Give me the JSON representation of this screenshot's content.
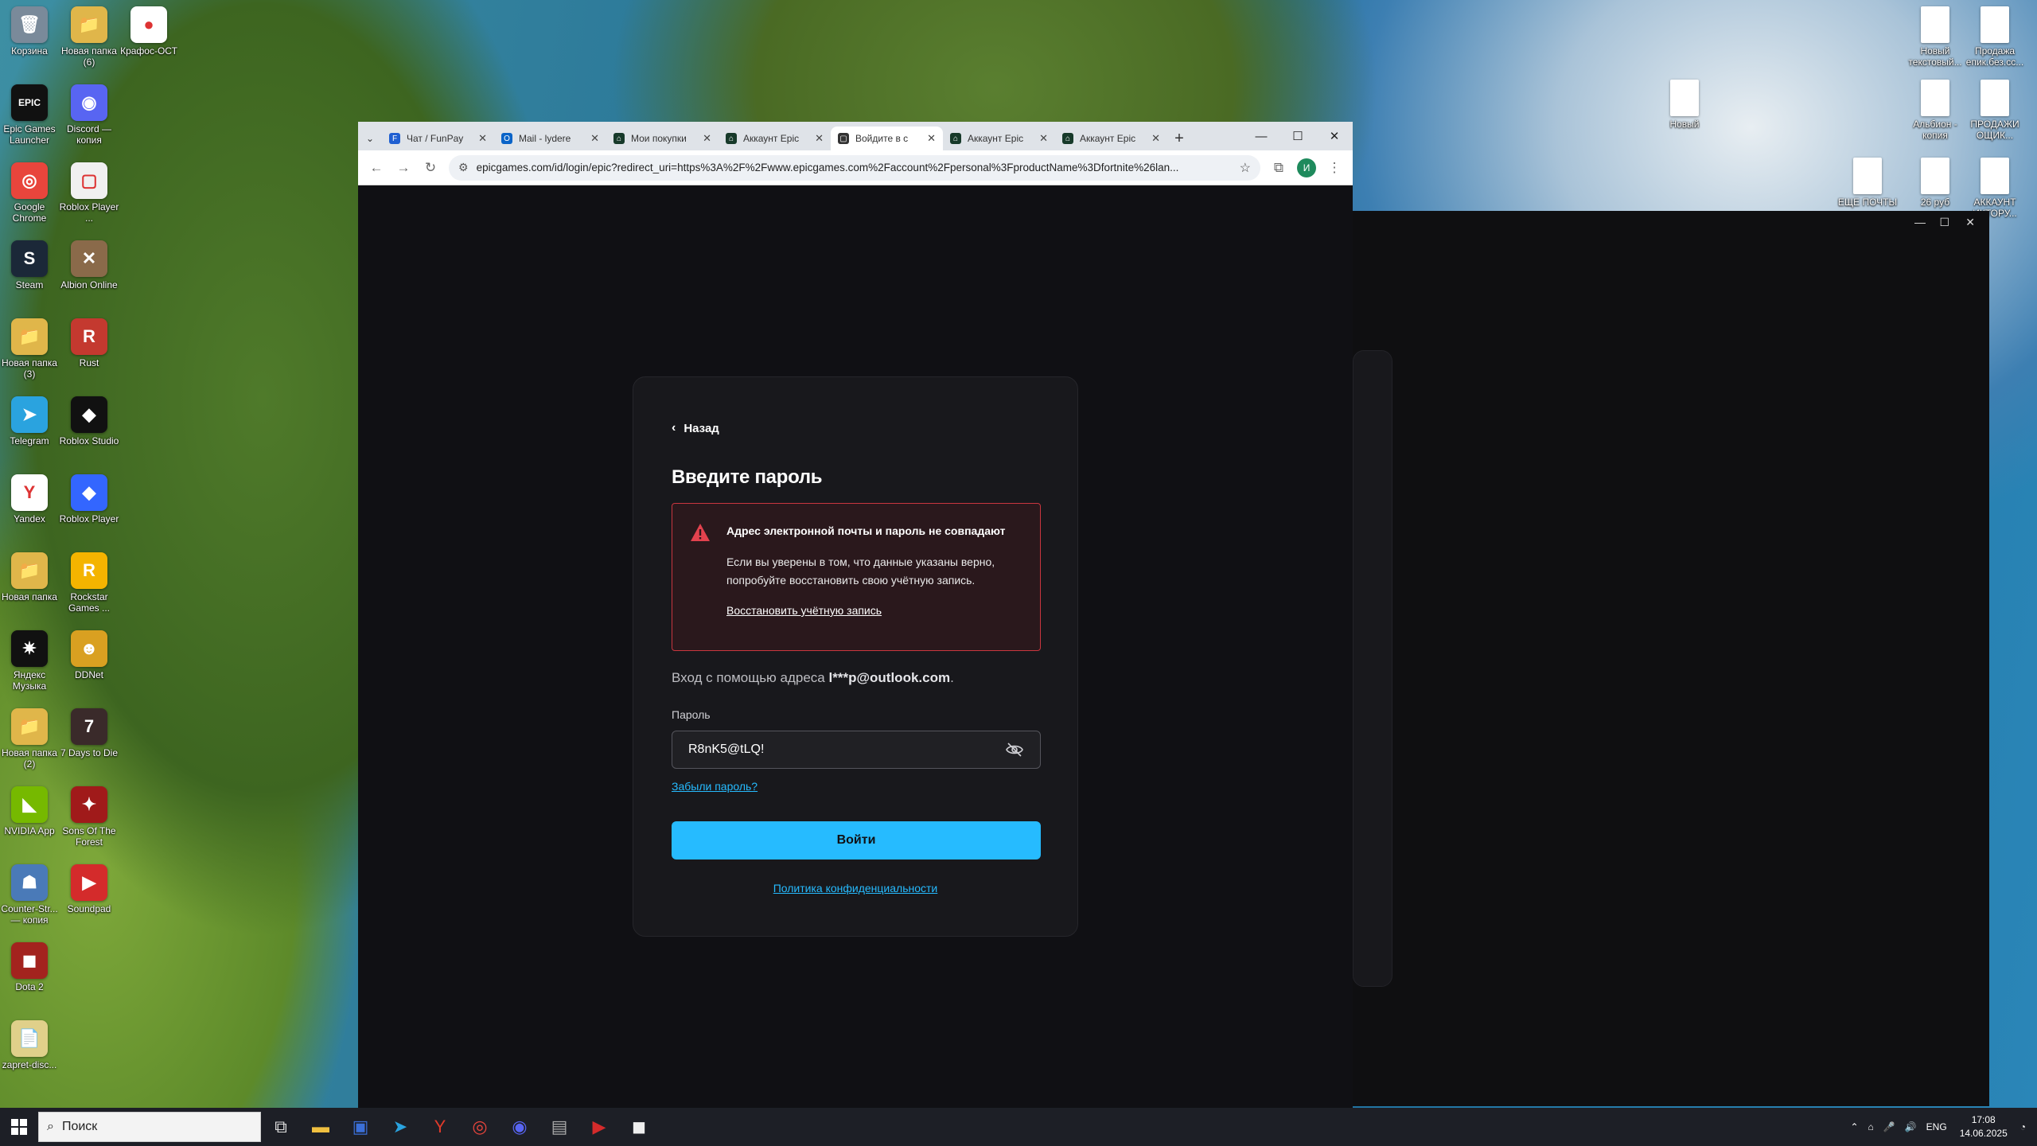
{
  "desktop": {
    "left_icons": [
      {
        "label": "Корзина",
        "color": "#7a8a9a",
        "glyph": "🗑"
      },
      {
        "label": "Новая папка (6)",
        "color": "#e0b64a",
        "glyph": "📁"
      },
      {
        "label": "Крафос-ОСТ",
        "color": "#ffffff",
        "glyph": "●"
      },
      {
        "label": "Epic Games Launcher",
        "color": "#111111",
        "glyph": "EPIC"
      },
      {
        "label": "Discord — копия",
        "color": "#5865f2",
        "glyph": "◉"
      },
      {
        "label": "Google Chrome",
        "color": "#e8453c",
        "glyph": "◎"
      },
      {
        "label": "Roblox Player ...",
        "color": "#f0f0f0",
        "glyph": "▢"
      },
      {
        "label": "Steam",
        "color": "#1b2838",
        "glyph": "S"
      },
      {
        "label": "Albion Online",
        "color": "#8a6a4a",
        "glyph": "✕"
      },
      {
        "label": "Новая папка (3)",
        "color": "#e0b64a",
        "glyph": "📁"
      },
      {
        "label": "Rust",
        "color": "#c4392f",
        "glyph": "R"
      },
      {
        "label": "Telegram",
        "color": "#2aa3df",
        "glyph": "➤"
      },
      {
        "label": "Roblox Studio",
        "color": "#111111",
        "glyph": "◆"
      },
      {
        "label": "Yandex",
        "color": "#ffffff",
        "glyph": "Y"
      },
      {
        "label": "Roblox Player",
        "color": "#3366ff",
        "glyph": "◆"
      },
      {
        "label": "Новая папка",
        "color": "#e0b64a",
        "glyph": "📁"
      },
      {
        "label": "Rockstar Games ...",
        "color": "#f4b400",
        "glyph": "R"
      },
      {
        "label": "Яндекс Музыка",
        "color": "#111111",
        "glyph": "✷"
      },
      {
        "label": "DDNet",
        "color": "#d9a021",
        "glyph": "☻"
      },
      {
        "label": "Новая папка (2)",
        "color": "#e0b64a",
        "glyph": "📁"
      },
      {
        "label": "7 Days to Die",
        "color": "#3a2a2a",
        "glyph": "7"
      },
      {
        "label": "NVIDIA App",
        "color": "#76b900",
        "glyph": "◣"
      },
      {
        "label": "Sons Of The Forest",
        "color": "#a01a1a",
        "glyph": "✦"
      },
      {
        "label": "Counter-Str... — копия",
        "color": "#4a7ab8",
        "glyph": "☗"
      },
      {
        "label": "Soundpad",
        "color": "#d42b2b",
        "glyph": "▶"
      },
      {
        "label": "Dota 2",
        "color": "#a3231e",
        "glyph": "◼"
      },
      {
        "label": "zapret-disc...",
        "color": "#e0d08a",
        "glyph": "📄"
      }
    ],
    "right_icons": [
      {
        "label": "Новый текстовый...",
        "color": "#ffffff"
      },
      {
        "label": "Продажа епик.без.сс...",
        "color": "#ffffff"
      },
      {
        "label": "Новый",
        "color": "#ffffff"
      },
      {
        "label": "Альбион - копия",
        "color": "#ffffff"
      },
      {
        "label": "ПРОДАЖИ ОЩИК...",
        "color": "#ffffff"
      },
      {
        "label": "ЕЩЕ ПОЧТЫ",
        "color": "#ffffff"
      },
      {
        "label": "26 руб",
        "color": "#ffffff"
      },
      {
        "label": "АККАУНТ ИКТОРУ...",
        "color": "#ffffff"
      }
    ]
  },
  "browser": {
    "tabs": [
      {
        "title": "Чат / FunPay",
        "fav": "#1f5fd1",
        "glyph": "F",
        "active": false
      },
      {
        "title": "Mail - lydere",
        "fav": "#0a64c8",
        "glyph": "O",
        "active": false
      },
      {
        "title": "Мои покупки",
        "fav": "#173a2a",
        "glyph": "⌂",
        "active": false
      },
      {
        "title": "Аккаунт Epic",
        "fav": "#173a2a",
        "glyph": "⌂",
        "active": false
      },
      {
        "title": "Войдите в с",
        "fav": "#333333",
        "glyph": "▢",
        "active": true
      },
      {
        "title": "Аккаунт Epic",
        "fav": "#173a2a",
        "glyph": "⌂",
        "active": false
      },
      {
        "title": "Аккаунт Epic",
        "fav": "#173a2a",
        "glyph": "⌂",
        "active": false
      }
    ],
    "url": "epicgames.com/id/login/epic?redirect_uri=https%3A%2F%2Fwww.epicgames.com%2Faccount%2Fpersonal%3FproductName%3Dfortnite%26lan...",
    "profile_initial": "И"
  },
  "login": {
    "back_label": "Назад",
    "heading": "Введите пароль",
    "error_title": "Адрес электронной почты и пароль не совпадают",
    "error_body": "Если вы уверены в том, что данные указаны верно, попробуйте восстановить свою учётную запись.",
    "error_link": "Восстановить учётную запись",
    "login_as_prefix": "Вход с помощью адреса",
    "login_as_email": "l***p@outlook.com",
    "password_label": "Пароль",
    "password_value": "R8nK5@tLQ!",
    "forgot_link": "Забыли пароль?",
    "signin_button": "Войти",
    "privacy_link": "Политика конфиденциальности"
  },
  "taskbar": {
    "search_placeholder": "Поиск",
    "language": "ENG",
    "time": "17:08",
    "date": "14.06.2025"
  }
}
